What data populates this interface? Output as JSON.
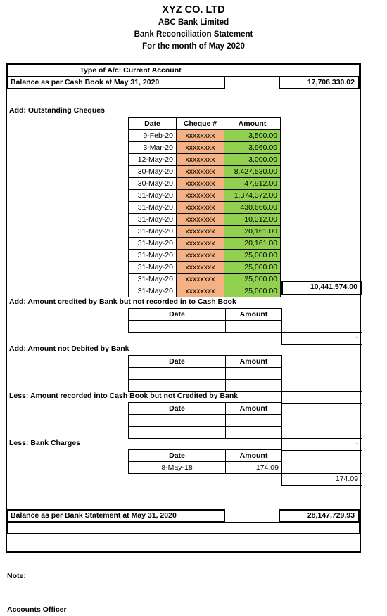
{
  "header": {
    "company": "XYZ CO. LTD",
    "bank": "ABC Bank Limited",
    "statement_title": "Bank Reconciliation Statement",
    "period": "For the month of May 2020"
  },
  "account": {
    "type_label": "Type of A/c: Current Account"
  },
  "opening": {
    "label": "Balance as per Cash Book at May 31, 2020",
    "amount": "17,706,330.02"
  },
  "closing": {
    "label": "Balance as per Bank Statement at May 31, 2020",
    "amount": "28,147,729.93"
  },
  "table_headers": {
    "date": "Date",
    "cheque": "Cheque #",
    "amount": "Amount"
  },
  "sections": {
    "outstanding_cheques": {
      "label": "Add: Outstanding Cheques",
      "total": "10,441,574.00",
      "rows": [
        {
          "date": "9-Feb-20",
          "cheque": "xxxxxxxx",
          "amount": "3,500.00"
        },
        {
          "date": "3-Mar-20",
          "cheque": "xxxxxxxx",
          "amount": "3,960.00"
        },
        {
          "date": "12-May-20",
          "cheque": "xxxxxxxx",
          "amount": "3,000.00"
        },
        {
          "date": "30-May-20",
          "cheque": "xxxxxxxx",
          "amount": "8,427,530.00"
        },
        {
          "date": "30-May-20",
          "cheque": "xxxxxxxx",
          "amount": "47,912.00"
        },
        {
          "date": "31-May-20",
          "cheque": "xxxxxxxx",
          "amount": "1,374,372.00"
        },
        {
          "date": "31-May-20",
          "cheque": "xxxxxxxx",
          "amount": "430,666.00"
        },
        {
          "date": "31-May-20",
          "cheque": "xxxxxxxx",
          "amount": "10,312.00"
        },
        {
          "date": "31-May-20",
          "cheque": "xxxxxxxx",
          "amount": "20,161.00"
        },
        {
          "date": "31-May-20",
          "cheque": "xxxxxxxx",
          "amount": "20,161.00"
        },
        {
          "date": "31-May-20",
          "cheque": "xxxxxxxx",
          "amount": "25,000.00"
        },
        {
          "date": "31-May-20",
          "cheque": "xxxxxxxx",
          "amount": "25,000.00"
        },
        {
          "date": "31-May-20",
          "cheque": "xxxxxxxx",
          "amount": "25,000.00"
        },
        {
          "date": "31-May-20",
          "cheque": "xxxxxxxx",
          "amount": "25,000.00"
        }
      ]
    },
    "credited_not_recorded": {
      "label": "Add: Amount credited by Bank but not recorded in to Cash Book",
      "total": "-",
      "rows": [
        {
          "date": "",
          "amount": ""
        }
      ]
    },
    "not_debited": {
      "label": "Add: Amount not Debited by Bank",
      "total": "",
      "rows": [
        {
          "date": "",
          "amount": ""
        },
        {
          "date": "",
          "amount": ""
        }
      ]
    },
    "recorded_not_credited": {
      "label": "Less: Amount recorded into Cash Book but not Credited by Bank",
      "total": "-",
      "rows": [
        {
          "date": "",
          "amount": ""
        },
        {
          "date": "",
          "amount": ""
        }
      ]
    },
    "bank_charges": {
      "label": "Less: Bank Charges",
      "total": "174.09",
      "rows": [
        {
          "date": "8-May-18",
          "amount": "174.09"
        }
      ]
    }
  },
  "footer": {
    "note_label": "Note:",
    "signatory": "Accounts Officer"
  },
  "colors": {
    "cheque_fill": "#F4B183",
    "amount_fill": "#92D050",
    "border": "#000000"
  }
}
